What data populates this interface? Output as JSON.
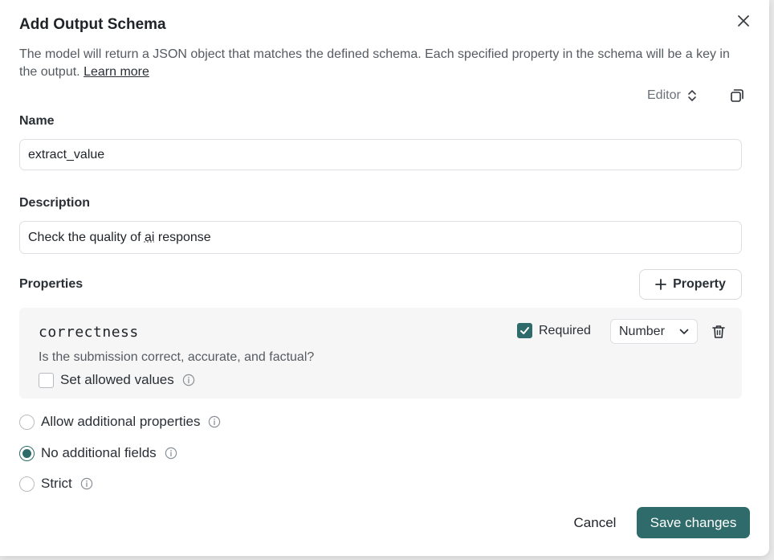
{
  "dialog": {
    "title": "Add Output Schema",
    "description": "The model will return a JSON object that matches the defined schema. Each specified property in the schema will be a key in the output.",
    "learn_more": "Learn more",
    "editor_toggle": "Editor"
  },
  "fields": {
    "name_label": "Name",
    "name_value": "extract_value",
    "description_label": "Description",
    "description_value_prefix": "Check the quality of ",
    "description_value_ai": "ai",
    "description_value_suffix": " response"
  },
  "properties": {
    "label": "Properties",
    "add_button": "Property",
    "items": [
      {
        "name": "correctness",
        "description": "Is the submission correct, accurate, and factual?",
        "required_label": "Required",
        "required": true,
        "type": "Number",
        "allowed_values_label": "Set allowed values",
        "allowed_values": false
      }
    ]
  },
  "options": {
    "allow_additional": "Allow additional properties",
    "no_additional": "No additional fields",
    "strict": "Strict",
    "selected": "no_additional"
  },
  "footer": {
    "cancel": "Cancel",
    "save": "Save changes"
  },
  "colors": {
    "accent": "#2e6b6a"
  }
}
